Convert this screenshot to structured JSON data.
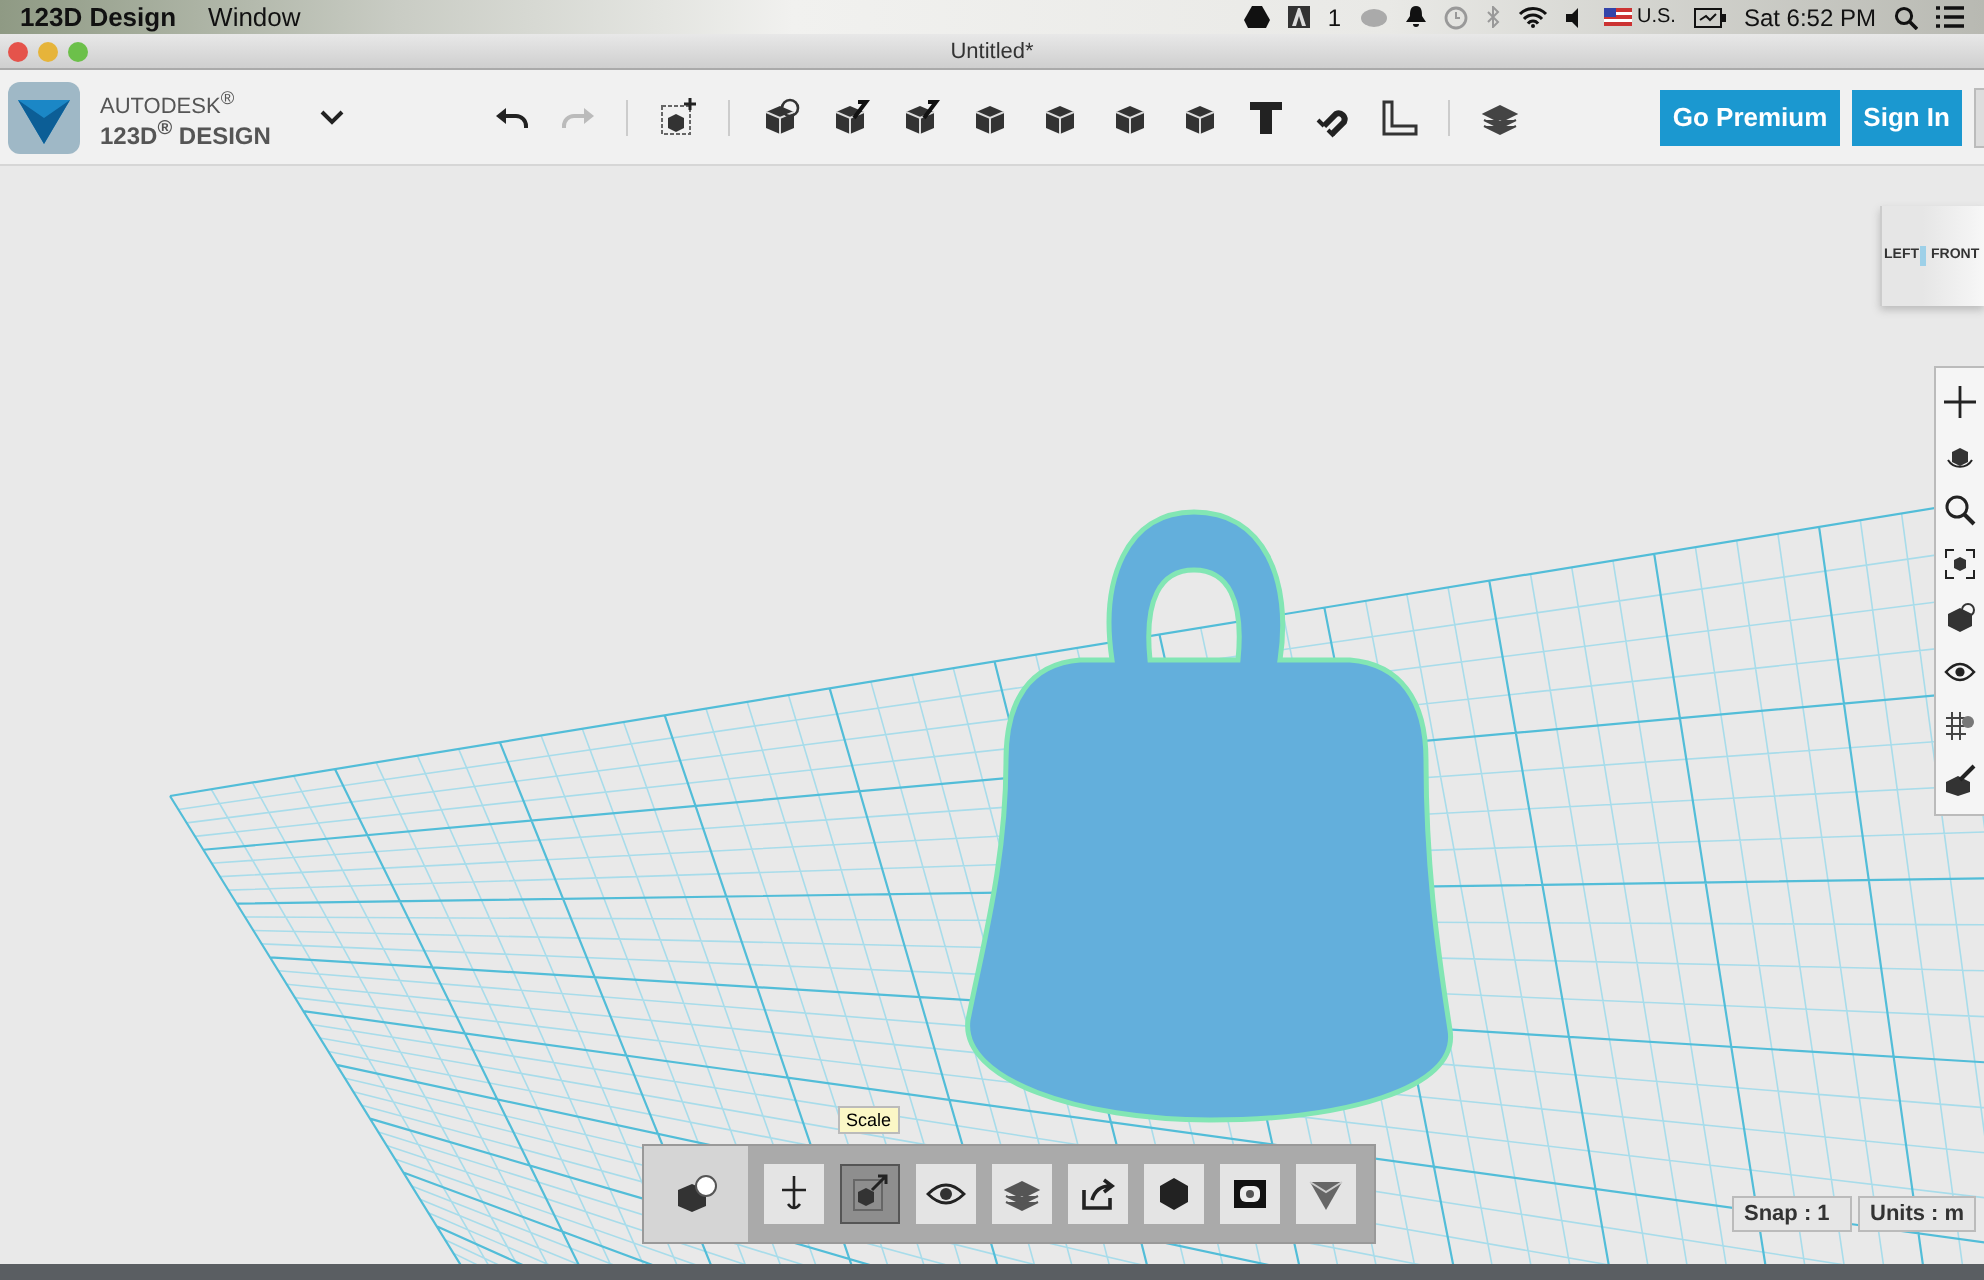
{
  "menu_bar": {
    "app_name": "123D Design",
    "menus": [
      "Window"
    ],
    "notification_count": "1",
    "input_source": "U.S.",
    "clock": "Sat 6:52 PM"
  },
  "window": {
    "title": "Untitled*"
  },
  "toolbar": {
    "brand": "AUTODESK$^{®}$",
    "product": "123D$^{®}$ DESIGN",
    "buttons": [
      {
        "label": "Go Premium"
      },
      {
        "label": "Sign In"
      }
    ]
  },
  "view_cube": {
    "faces": [
      "LEFT",
      "FRONT"
    ]
  },
  "bottom_toolbar": {
    "tooltip": "Scale",
    "tools": [
      {
        "kind": "move",
        "selected": false
      },
      {
        "kind": "scale",
        "selected": true
      },
      {
        "kind": "eye",
        "selected": false
      },
      {
        "kind": "layers",
        "selected": false
      },
      {
        "kind": "export",
        "selected": false
      },
      {
        "kind": "solid",
        "selected": false
      },
      {
        "kind": "frame",
        "selected": false
      },
      {
        "kind": "funnel",
        "selected": false
      }
    ]
  },
  "status": {
    "snap": "Snap : 1",
    "units": "Units : m"
  }
}
